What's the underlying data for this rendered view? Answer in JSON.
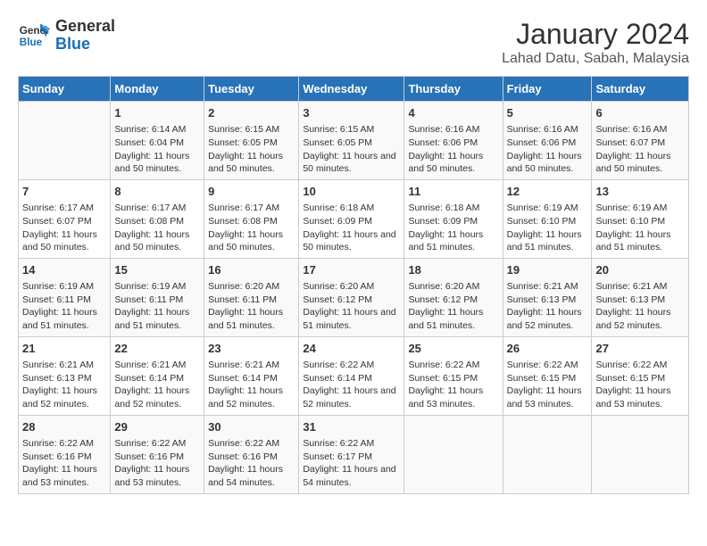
{
  "logo": {
    "line1": "General",
    "line2": "Blue"
  },
  "title": "January 2024",
  "subtitle": "Lahad Datu, Sabah, Malaysia",
  "headers": [
    "Sunday",
    "Monday",
    "Tuesday",
    "Wednesday",
    "Thursday",
    "Friday",
    "Saturday"
  ],
  "weeks": [
    [
      {
        "day": "",
        "sunrise": "",
        "sunset": "",
        "daylight": ""
      },
      {
        "day": "1",
        "sunrise": "Sunrise: 6:14 AM",
        "sunset": "Sunset: 6:04 PM",
        "daylight": "Daylight: 11 hours and 50 minutes."
      },
      {
        "day": "2",
        "sunrise": "Sunrise: 6:15 AM",
        "sunset": "Sunset: 6:05 PM",
        "daylight": "Daylight: 11 hours and 50 minutes."
      },
      {
        "day": "3",
        "sunrise": "Sunrise: 6:15 AM",
        "sunset": "Sunset: 6:05 PM",
        "daylight": "Daylight: 11 hours and 50 minutes."
      },
      {
        "day": "4",
        "sunrise": "Sunrise: 6:16 AM",
        "sunset": "Sunset: 6:06 PM",
        "daylight": "Daylight: 11 hours and 50 minutes."
      },
      {
        "day": "5",
        "sunrise": "Sunrise: 6:16 AM",
        "sunset": "Sunset: 6:06 PM",
        "daylight": "Daylight: 11 hours and 50 minutes."
      },
      {
        "day": "6",
        "sunrise": "Sunrise: 6:16 AM",
        "sunset": "Sunset: 6:07 PM",
        "daylight": "Daylight: 11 hours and 50 minutes."
      }
    ],
    [
      {
        "day": "7",
        "sunrise": "Sunrise: 6:17 AM",
        "sunset": "Sunset: 6:07 PM",
        "daylight": "Daylight: 11 hours and 50 minutes."
      },
      {
        "day": "8",
        "sunrise": "Sunrise: 6:17 AM",
        "sunset": "Sunset: 6:08 PM",
        "daylight": "Daylight: 11 hours and 50 minutes."
      },
      {
        "day": "9",
        "sunrise": "Sunrise: 6:17 AM",
        "sunset": "Sunset: 6:08 PM",
        "daylight": "Daylight: 11 hours and 50 minutes."
      },
      {
        "day": "10",
        "sunrise": "Sunrise: 6:18 AM",
        "sunset": "Sunset: 6:09 PM",
        "daylight": "Daylight: 11 hours and 50 minutes."
      },
      {
        "day": "11",
        "sunrise": "Sunrise: 6:18 AM",
        "sunset": "Sunset: 6:09 PM",
        "daylight": "Daylight: 11 hours and 51 minutes."
      },
      {
        "day": "12",
        "sunrise": "Sunrise: 6:19 AM",
        "sunset": "Sunset: 6:10 PM",
        "daylight": "Daylight: 11 hours and 51 minutes."
      },
      {
        "day": "13",
        "sunrise": "Sunrise: 6:19 AM",
        "sunset": "Sunset: 6:10 PM",
        "daylight": "Daylight: 11 hours and 51 minutes."
      }
    ],
    [
      {
        "day": "14",
        "sunrise": "Sunrise: 6:19 AM",
        "sunset": "Sunset: 6:11 PM",
        "daylight": "Daylight: 11 hours and 51 minutes."
      },
      {
        "day": "15",
        "sunrise": "Sunrise: 6:19 AM",
        "sunset": "Sunset: 6:11 PM",
        "daylight": "Daylight: 11 hours and 51 minutes."
      },
      {
        "day": "16",
        "sunrise": "Sunrise: 6:20 AM",
        "sunset": "Sunset: 6:11 PM",
        "daylight": "Daylight: 11 hours and 51 minutes."
      },
      {
        "day": "17",
        "sunrise": "Sunrise: 6:20 AM",
        "sunset": "Sunset: 6:12 PM",
        "daylight": "Daylight: 11 hours and 51 minutes."
      },
      {
        "day": "18",
        "sunrise": "Sunrise: 6:20 AM",
        "sunset": "Sunset: 6:12 PM",
        "daylight": "Daylight: 11 hours and 51 minutes."
      },
      {
        "day": "19",
        "sunrise": "Sunrise: 6:21 AM",
        "sunset": "Sunset: 6:13 PM",
        "daylight": "Daylight: 11 hours and 52 minutes."
      },
      {
        "day": "20",
        "sunrise": "Sunrise: 6:21 AM",
        "sunset": "Sunset: 6:13 PM",
        "daylight": "Daylight: 11 hours and 52 minutes."
      }
    ],
    [
      {
        "day": "21",
        "sunrise": "Sunrise: 6:21 AM",
        "sunset": "Sunset: 6:13 PM",
        "daylight": "Daylight: 11 hours and 52 minutes."
      },
      {
        "day": "22",
        "sunrise": "Sunrise: 6:21 AM",
        "sunset": "Sunset: 6:14 PM",
        "daylight": "Daylight: 11 hours and 52 minutes."
      },
      {
        "day": "23",
        "sunrise": "Sunrise: 6:21 AM",
        "sunset": "Sunset: 6:14 PM",
        "daylight": "Daylight: 11 hours and 52 minutes."
      },
      {
        "day": "24",
        "sunrise": "Sunrise: 6:22 AM",
        "sunset": "Sunset: 6:14 PM",
        "daylight": "Daylight: 11 hours and 52 minutes."
      },
      {
        "day": "25",
        "sunrise": "Sunrise: 6:22 AM",
        "sunset": "Sunset: 6:15 PM",
        "daylight": "Daylight: 11 hours and 53 minutes."
      },
      {
        "day": "26",
        "sunrise": "Sunrise: 6:22 AM",
        "sunset": "Sunset: 6:15 PM",
        "daylight": "Daylight: 11 hours and 53 minutes."
      },
      {
        "day": "27",
        "sunrise": "Sunrise: 6:22 AM",
        "sunset": "Sunset: 6:15 PM",
        "daylight": "Daylight: 11 hours and 53 minutes."
      }
    ],
    [
      {
        "day": "28",
        "sunrise": "Sunrise: 6:22 AM",
        "sunset": "Sunset: 6:16 PM",
        "daylight": "Daylight: 11 hours and 53 minutes."
      },
      {
        "day": "29",
        "sunrise": "Sunrise: 6:22 AM",
        "sunset": "Sunset: 6:16 PM",
        "daylight": "Daylight: 11 hours and 53 minutes."
      },
      {
        "day": "30",
        "sunrise": "Sunrise: 6:22 AM",
        "sunset": "Sunset: 6:16 PM",
        "daylight": "Daylight: 11 hours and 54 minutes."
      },
      {
        "day": "31",
        "sunrise": "Sunrise: 6:22 AM",
        "sunset": "Sunset: 6:17 PM",
        "daylight": "Daylight: 11 hours and 54 minutes."
      },
      {
        "day": "",
        "sunrise": "",
        "sunset": "",
        "daylight": ""
      },
      {
        "day": "",
        "sunrise": "",
        "sunset": "",
        "daylight": ""
      },
      {
        "day": "",
        "sunrise": "",
        "sunset": "",
        "daylight": ""
      }
    ]
  ]
}
